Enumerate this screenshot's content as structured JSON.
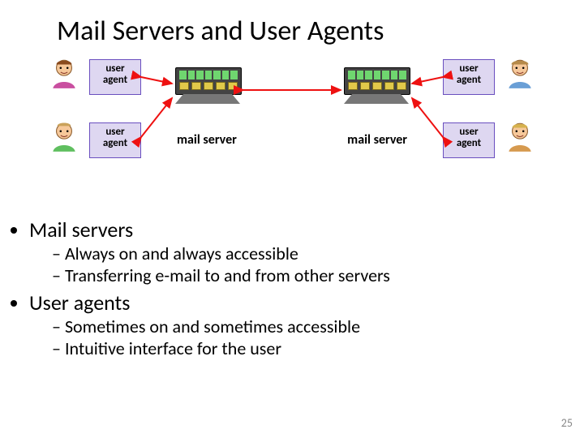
{
  "title": "Mail Servers and User Agents",
  "ua_label_line1": "user",
  "ua_label_line2": "agent",
  "server_caption": "mail server",
  "bullets": {
    "b1": "Mail servers",
    "b1a": "Always on and always accessible",
    "b1b": "Transferring e-mail to and from other servers",
    "b2": "User agents",
    "b2a": "Sometimes on and sometimes accessible",
    "b2b": "Intuitive interface for the user"
  },
  "page_number": "25"
}
